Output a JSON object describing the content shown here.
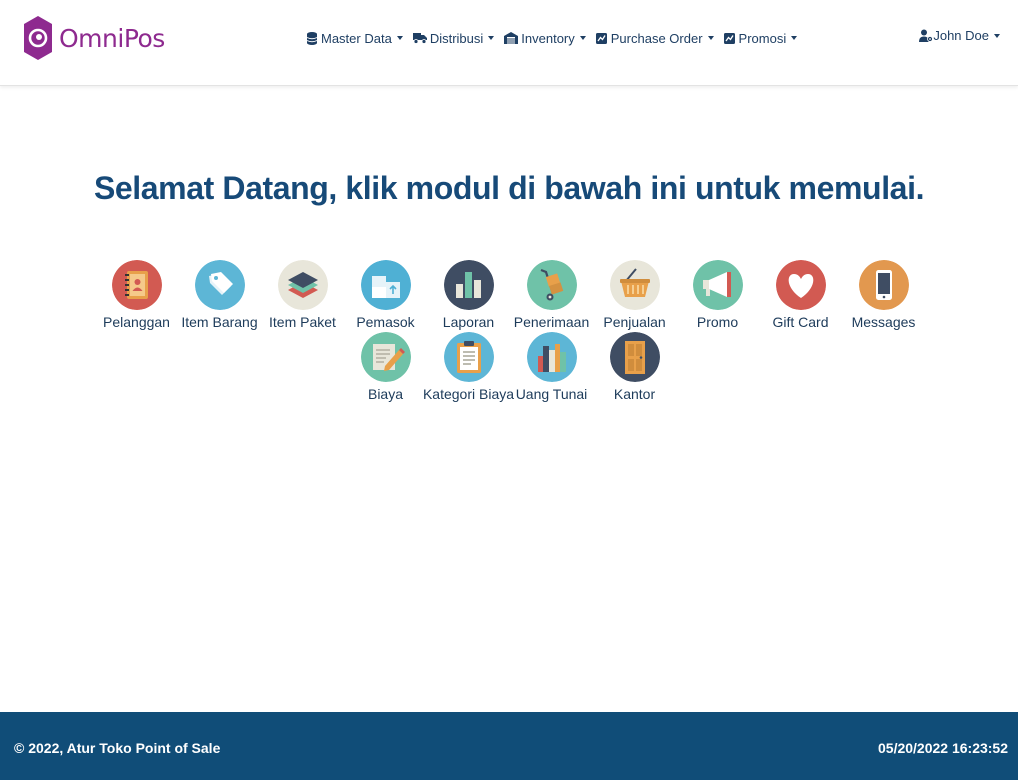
{
  "brand": {
    "name": "OmniPos"
  },
  "nav": {
    "items": [
      {
        "label": "Master Data",
        "icon": "database-icon"
      },
      {
        "label": "Distribusi",
        "icon": "truck-icon"
      },
      {
        "label": "Inventory",
        "icon": "warehouse-icon"
      },
      {
        "label": "Purchase Order",
        "icon": "chart-box-icon"
      },
      {
        "label": "Promosi",
        "icon": "chart-box-icon"
      }
    ],
    "user": {
      "label": "John Doe",
      "icon": "user-gear-icon"
    }
  },
  "main": {
    "welcome": "Selamat Datang, klik modul di bawah ini untuk memulai.",
    "modules_row1": [
      {
        "label": "Pelanggan",
        "icon": "address-book-icon",
        "color": "#d25a52"
      },
      {
        "label": "Item Barang",
        "icon": "price-tag-icon",
        "color": "#5db6d6"
      },
      {
        "label": "Item Paket",
        "icon": "layers-icon",
        "color": "#e8e6da"
      },
      {
        "label": "Pemasok",
        "icon": "boxes-icon",
        "color": "#4fb0d4"
      },
      {
        "label": "Laporan",
        "icon": "bar-chart-icon",
        "color": "#3f4d63"
      },
      {
        "label": "Penerimaan",
        "icon": "hand-truck-icon",
        "color": "#6fc2a8"
      },
      {
        "label": "Penjualan",
        "icon": "basket-icon",
        "color": "#e8e6da"
      },
      {
        "label": "Promo",
        "icon": "megaphone-icon",
        "color": "#6fc2a8"
      },
      {
        "label": "Gift Card",
        "icon": "heart-icon",
        "color": "#d25a52"
      },
      {
        "label": "Messages",
        "icon": "smartphone-icon",
        "color": "#e2984f"
      }
    ],
    "modules_row2": [
      {
        "label": "Biaya",
        "icon": "pencil-note-icon",
        "color": "#6fc2a8"
      },
      {
        "label": "Kategori Biaya",
        "icon": "clipboard-icon",
        "color": "#5db6d6"
      },
      {
        "label": "Uang Tunai",
        "icon": "books-icon",
        "color": "#5db6d6"
      },
      {
        "label": "Kantor",
        "icon": "door-icon",
        "color": "#3f4d63"
      }
    ]
  },
  "footer": {
    "copyright": "© 2022, Atur Toko Point of Sale",
    "datetime": "05/20/2022 16:23:52"
  }
}
